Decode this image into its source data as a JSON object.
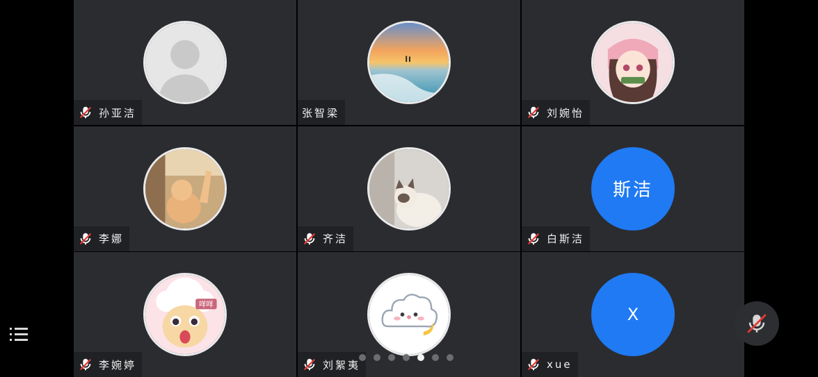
{
  "participants": [
    {
      "name": "孙亚洁",
      "avatar": "default-person",
      "muted": true
    },
    {
      "name": "张智梁",
      "avatar": "sunset-beach-photo",
      "muted": false
    },
    {
      "name": "刘婉怡",
      "avatar": "anime-girl-photo",
      "muted": true
    },
    {
      "name": "李娜",
      "avatar": "cat-photo",
      "muted": true
    },
    {
      "name": "齐洁",
      "avatar": "ragdoll-cat-photo",
      "muted": true
    },
    {
      "name": "白斯洁",
      "avatar_text": "斯洁",
      "avatar_color": "#1f7af3",
      "muted": true
    },
    {
      "name": "李婉婷",
      "avatar": "cartoon-sheep",
      "avatar_badge": "咩咩",
      "muted": true
    },
    {
      "name": "刘絮夷",
      "avatar": "cloud-sticker",
      "muted": true
    },
    {
      "name": "xue",
      "avatar_text": "X",
      "avatar_color": "#1f7af3",
      "muted": true
    }
  ],
  "controls": {
    "menu_icon": "list-menu-icon",
    "mic_icon": "mic-muted-icon"
  },
  "pagination": {
    "total": 7,
    "active": 5
  }
}
